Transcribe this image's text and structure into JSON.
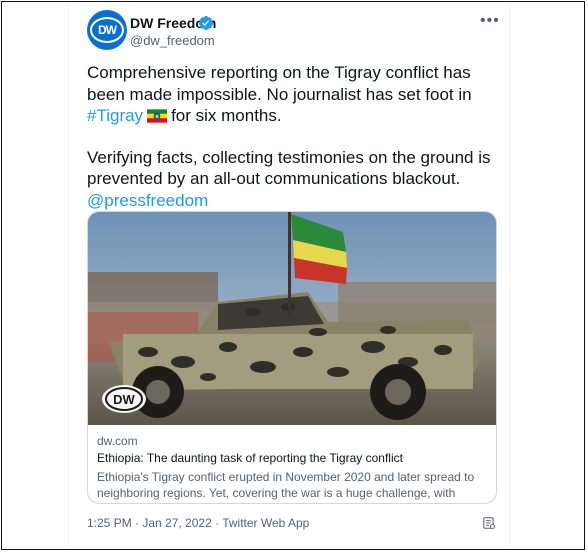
{
  "account": {
    "name": "DW Freedom",
    "handle": "@dw_freedom",
    "avatar_text": "DW"
  },
  "tweet": {
    "line1": "Comprehensive reporting on the Tigray conflict has",
    "line2": "been made impossible. No journalist has set foot in",
    "hashtag": "#Tigray",
    "line3_rest": "for six months.",
    "para2_line1": "Verifying facts, collecting testimonies on the ground is",
    "para2_line2": "prevented by an all-out communications blackout.",
    "mention": "@pressfreedom"
  },
  "card": {
    "domain": "dw.com",
    "title": "Ethiopia: The daunting task of reporting the Tigray conflict",
    "desc_line1": "Ethiopia's Tigray conflict erupted in November 2020 and later spread to",
    "desc_line2": "neighboring regions. Yet, covering the war is a huge challenge, with press ...",
    "logo_text": "DW"
  },
  "meta": {
    "timestamp": "1:25 PM · Jan 27, 2022 · Twitter Web App"
  },
  "icons": {
    "more": "more-options-icon",
    "verified": "verified-badge-icon",
    "analytics": "analytics-icon"
  },
  "colors": {
    "link": "#1d9bf0",
    "brand": "#0a6fd1",
    "text": "#0f1419",
    "muted": "#536471"
  }
}
